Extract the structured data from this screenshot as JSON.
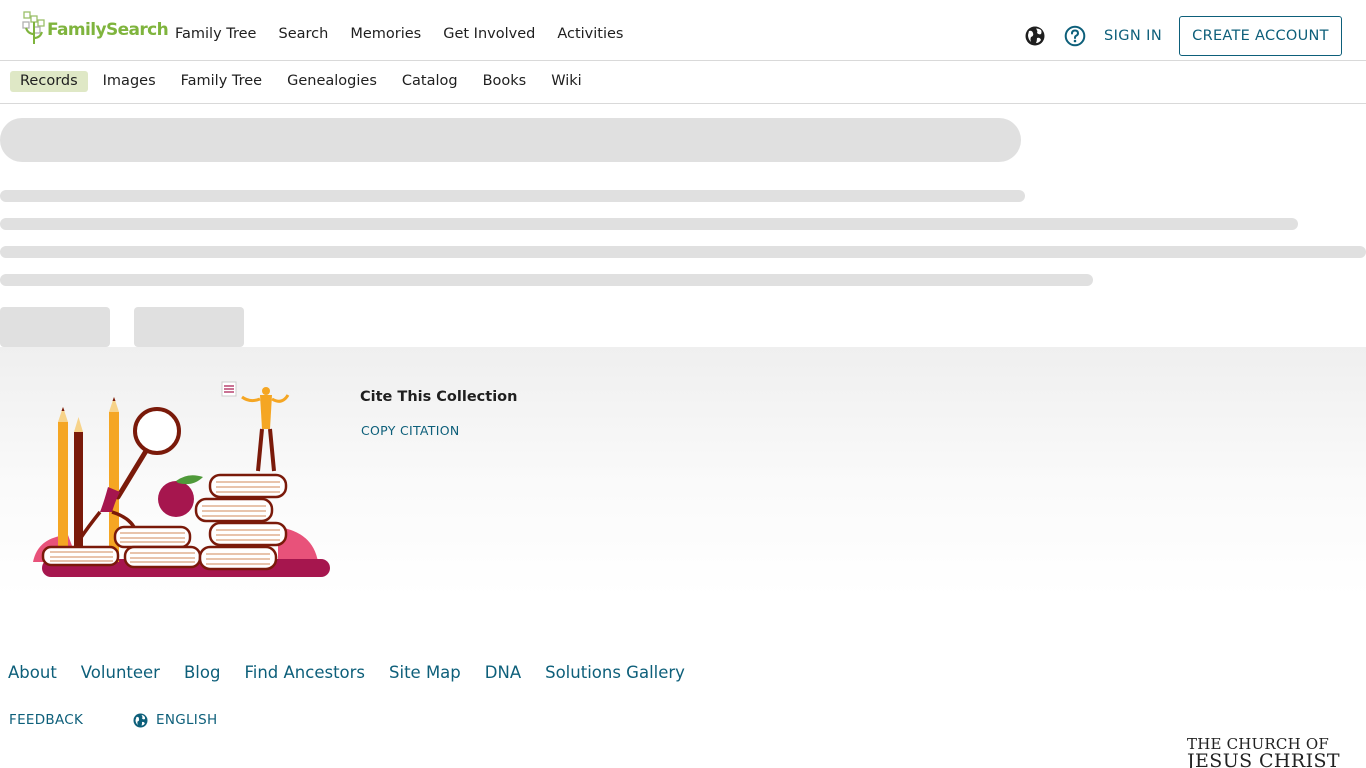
{
  "header": {
    "logo_text": "FamilySearch",
    "nav": [
      "Family Tree",
      "Search",
      "Memories",
      "Get Involved",
      "Activities"
    ],
    "globe_icon": "globe-icon",
    "help_icon": "help-circle-icon",
    "signin_label": "SIGN IN",
    "create_account_label": "CREATE ACCOUNT"
  },
  "subnav": {
    "items": [
      "Records",
      "Images",
      "Family Tree",
      "Genealogies",
      "Catalog",
      "Books",
      "Wiki"
    ],
    "active": "Records"
  },
  "cite": {
    "title": "Cite This Collection",
    "copy_label": "COPY CITATION",
    "illustration": "books-research-illustration"
  },
  "footer": {
    "links": [
      "About",
      "Volunteer",
      "Blog",
      "Find Ancestors",
      "Site Map",
      "DNA",
      "Solutions Gallery"
    ],
    "feedback_label": "FEEDBACK",
    "language_label": "ENGLISH",
    "church_line1": "THE CHURCH OF",
    "church_line2": "JESUS CHRIST"
  },
  "colors": {
    "accent": "#0d5f7a",
    "brand_green": "#7fb43d",
    "active_tab": "#dfe8c6",
    "skeleton": "#e0e0e0"
  }
}
